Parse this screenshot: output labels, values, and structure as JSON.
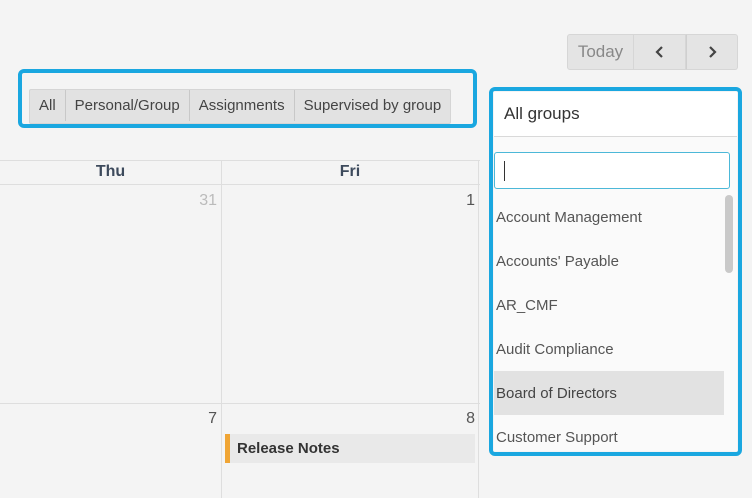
{
  "nav": {
    "today_label": "Today",
    "prev_icon": "chevron-left-icon",
    "next_icon": "chevron-right-icon"
  },
  "filters": {
    "tabs": [
      {
        "label": "All"
      },
      {
        "label": "Personal/Group"
      },
      {
        "label": "Assignments"
      },
      {
        "label": "Supervised by group"
      }
    ]
  },
  "calendar": {
    "days": [
      {
        "label": "Thu"
      },
      {
        "label": "Fri"
      }
    ],
    "week1": {
      "thu": "31",
      "fri": "1"
    },
    "week2": {
      "thu": "7",
      "fri": "8"
    },
    "event": {
      "title": "Release Notes",
      "color": "#f0a535"
    }
  },
  "groups_dropdown": {
    "selected": "All groups",
    "search_value": "",
    "options": [
      {
        "label": "Account Management"
      },
      {
        "label": "Accounts' Payable"
      },
      {
        "label": "AR_CMF"
      },
      {
        "label": "Audit Compliance"
      },
      {
        "label": "Board of Directors"
      },
      {
        "label": "Customer Support"
      }
    ],
    "highlighted_option": "Board of Directors"
  },
  "colors": {
    "highlight": "#1aa7e0",
    "event_accent": "#f0a535"
  }
}
